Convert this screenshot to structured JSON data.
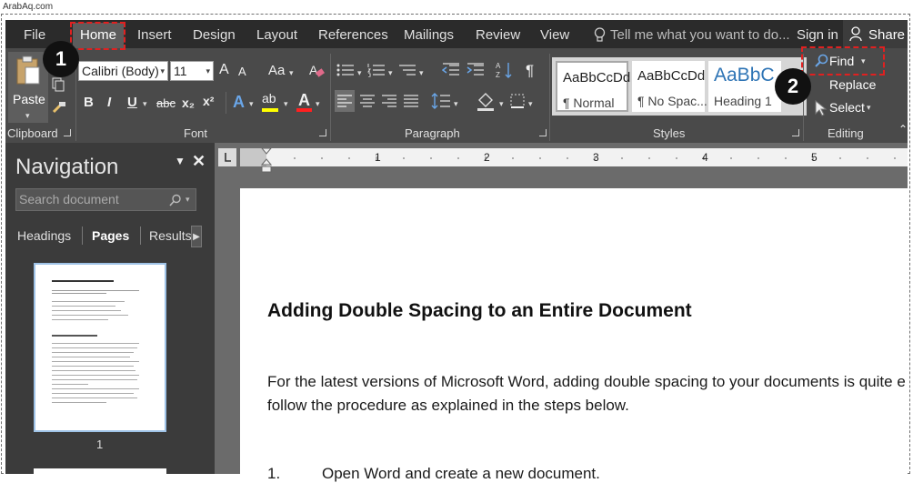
{
  "watermark": "ArabAq.com",
  "tabs": [
    "File",
    "Home",
    "Insert",
    "Design",
    "Layout",
    "References",
    "Mailings",
    "Review",
    "View"
  ],
  "tell_me": "Tell me what you want to do...",
  "sign_in": "Sign in",
  "share": "Share",
  "clipboard": {
    "paste": "Paste",
    "label": "Clipboard"
  },
  "font": {
    "name": "Calibri (Body)",
    "size": "11",
    "label": "Font",
    "case_label": "Aa",
    "grow": "A",
    "shrink": "A",
    "bold": "B",
    "italic": "I",
    "underline": "U",
    "strike": "abc",
    "subscript": "x₂",
    "superscript": "x²",
    "effects": "A",
    "highlight": "ab",
    "color": "A"
  },
  "paragraph": {
    "label": "Paragraph",
    "pilcrow": "¶"
  },
  "styles": {
    "label": "Styles",
    "items": [
      {
        "sample": "AaBbCcDd",
        "name": "¶ Normal"
      },
      {
        "sample": "AaBbCcDd",
        "name": "¶ No Spac..."
      },
      {
        "sample": "AaBbC",
        "name": "Heading 1"
      }
    ]
  },
  "editing": {
    "label": "Editing",
    "find": "Find",
    "replace": "Replace",
    "select": "Select"
  },
  "navigation": {
    "title": "Navigation",
    "search_placeholder": "Search document",
    "tabs": [
      "Headings",
      "Pages",
      "Results"
    ],
    "active_tab": "Pages",
    "page_number": "1"
  },
  "ruler_numbers": [
    "1",
    "2",
    "3",
    "4",
    "5"
  ],
  "document": {
    "heading": "Adding Double Spacing to an Entire Document",
    "para_line1": "For the latest versions of Microsoft Word, adding double spacing to your documents is quite e",
    "para_line2": "follow the procedure as explained in the steps below.",
    "step_num": "1.",
    "step_text": "Open Word and create a new document."
  },
  "badges": [
    "1",
    "2"
  ],
  "colors": {
    "highlight": "#ffff00",
    "font_color": "#ff0000",
    "annotation": "#e02020",
    "ribbon": "#4a4a4a",
    "tabbar": "#2b2b2b"
  }
}
